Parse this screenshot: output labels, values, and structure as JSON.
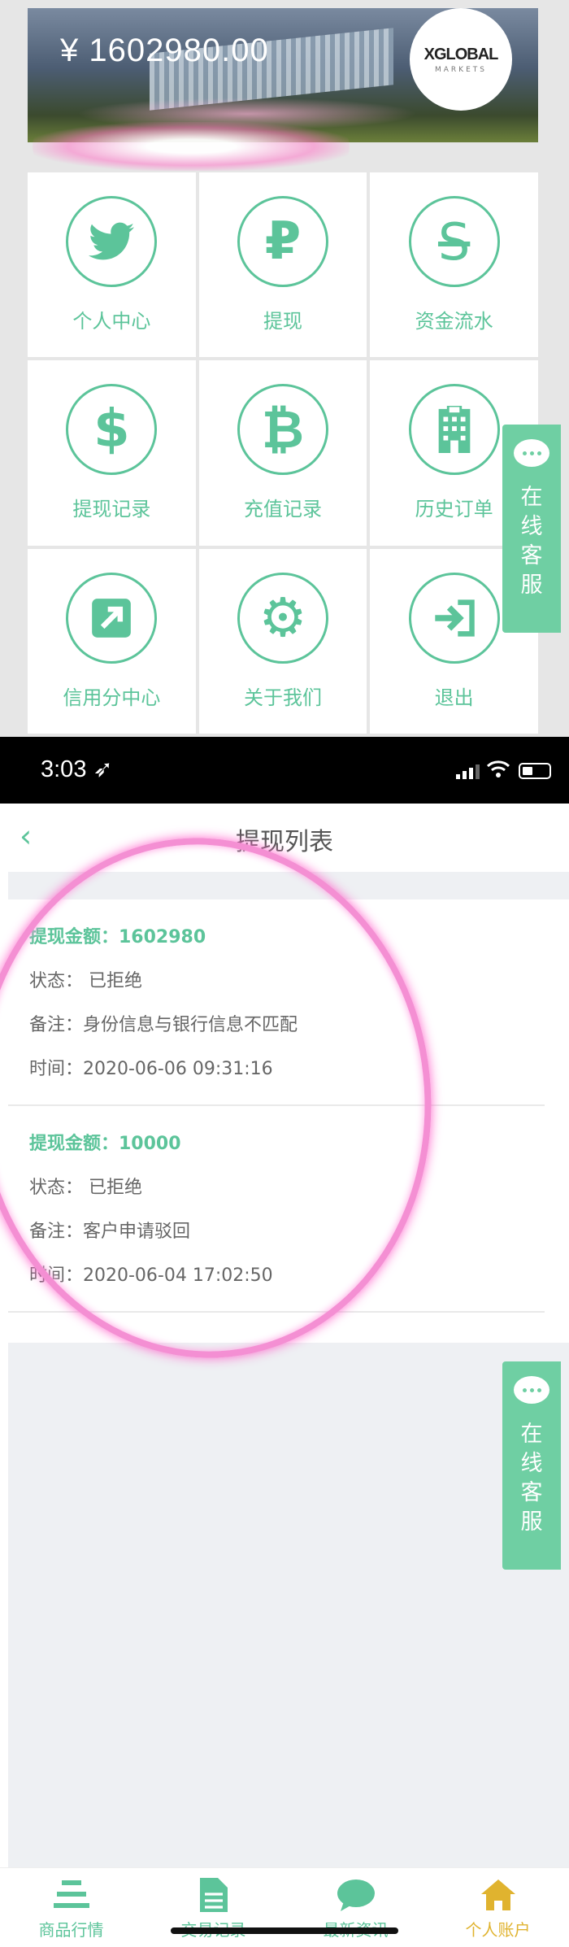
{
  "account": {
    "balance": "¥ 1602980.00",
    "logo_main": "XGLOBAL",
    "logo_sub": "MARKETS"
  },
  "menu": [
    {
      "label": "个人中心",
      "icon": "twitter-bird-icon"
    },
    {
      "label": "提现",
      "icon": "ruble-icon"
    },
    {
      "label": "资金流水",
      "icon": "strikethrough-s-icon"
    },
    {
      "label": "提现记录",
      "icon": "dollar-icon"
    },
    {
      "label": "充值记录",
      "icon": "bitcoin-icon"
    },
    {
      "label": "历史订单",
      "icon": "building-icon"
    },
    {
      "label": "信用分中心",
      "icon": "external-link-icon"
    },
    {
      "label": "关于我们",
      "icon": "gear-icon"
    },
    {
      "label": "退出",
      "icon": "sign-in-icon"
    }
  ],
  "service": {
    "label": "在线客服"
  },
  "status_bar": {
    "time": "3:03"
  },
  "withdraw_page": {
    "title": "提现列表",
    "records": [
      {
        "amount": "提现金额：1602980",
        "status": "状态：  已拒绝",
        "note": "备注：身份信息与银行信息不匹配",
        "time": "时间：2020-06-06 09:31:16"
      },
      {
        "amount": "提现金额：10000",
        "status": "状态：  已拒绝",
        "note": "备注：客户申请驳回",
        "time": "时间：2020-06-04 17:02:50"
      }
    ]
  },
  "tabs": [
    {
      "label": "商品行情",
      "icon": "list-icon"
    },
    {
      "label": "交易记录",
      "icon": "document-icon"
    },
    {
      "label": "最新资讯",
      "icon": "chat-bubble-icon"
    },
    {
      "label": "个人账户",
      "icon": "home-icon"
    }
  ],
  "colors": {
    "accent": "#5cc49a",
    "service_bg": "#6fcfa3",
    "active_tab": "#e0b32f",
    "highlight": "#f48fd3"
  }
}
